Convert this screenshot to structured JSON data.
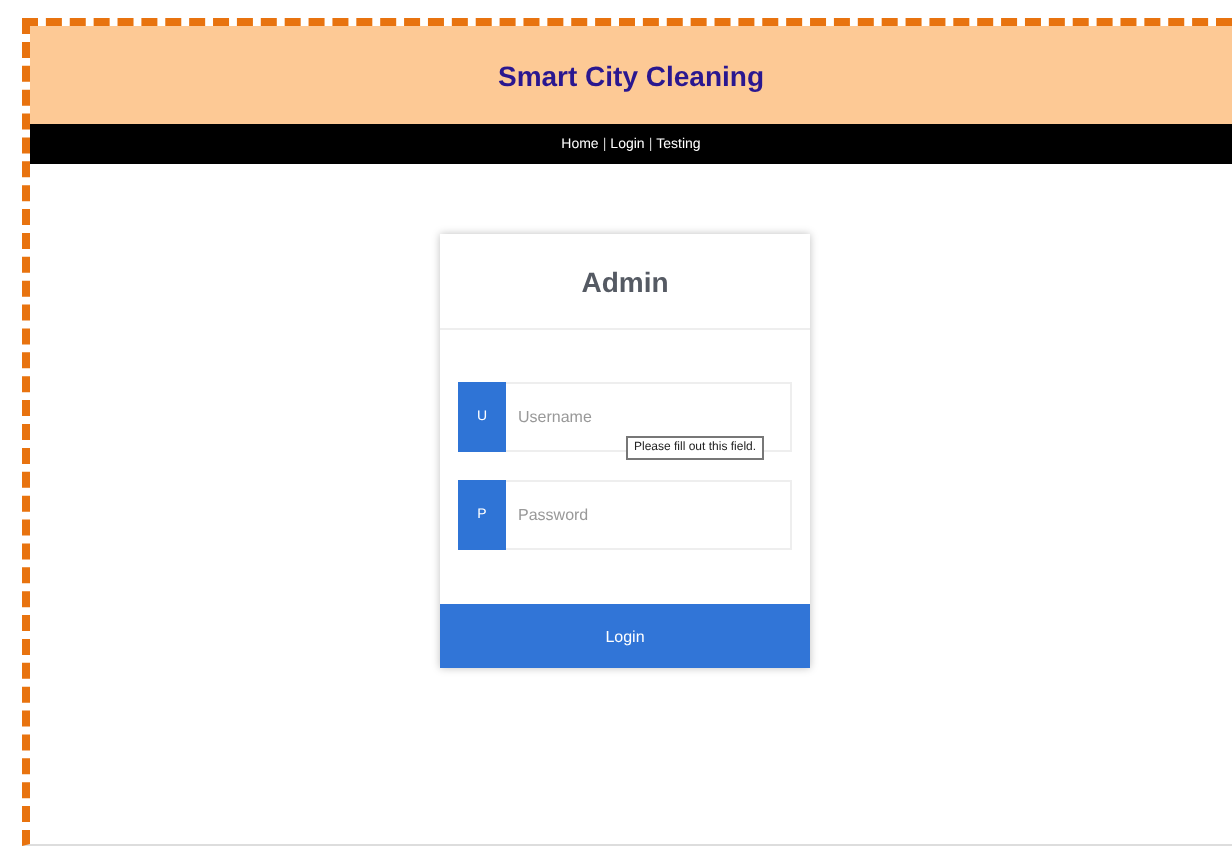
{
  "header": {
    "title": "Smart City Cleaning"
  },
  "nav": [
    {
      "kind": "link",
      "text": "Home"
    },
    {
      "kind": "separator",
      "text": "|"
    },
    {
      "kind": "link",
      "text": "Login"
    },
    {
      "kind": "separator",
      "text": "|"
    },
    {
      "kind": "link",
      "text": "Testing"
    }
  ],
  "login_card": {
    "title": "Admin",
    "fields": [
      {
        "icon_letter": "U",
        "placeholder": "Username"
      },
      {
        "icon_letter": "P",
        "placeholder": "Password"
      }
    ],
    "tooltip": "Please fill out this field.",
    "button": "Login"
  }
}
